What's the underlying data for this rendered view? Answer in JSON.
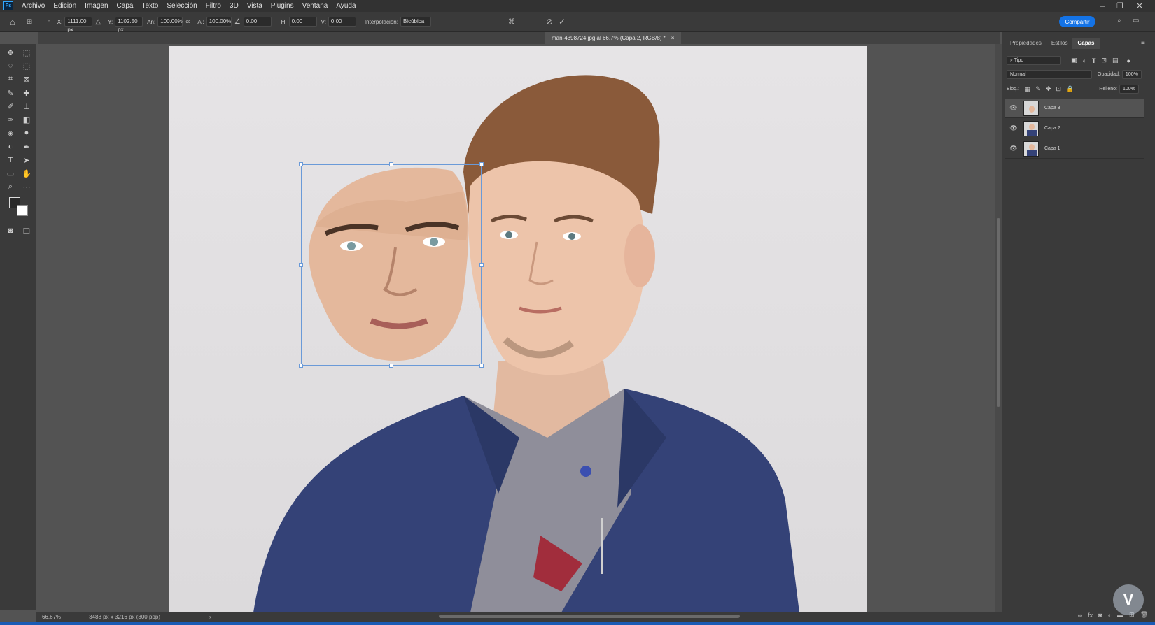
{
  "menu": [
    "Archivo",
    "Edición",
    "Imagen",
    "Capa",
    "Texto",
    "Selección",
    "Filtro",
    "3D",
    "Vista",
    "Plugins",
    "Ventana",
    "Ayuda"
  ],
  "app_logo": "Ps",
  "options": {
    "x_label": "X:",
    "x_value": "1111.00 px",
    "y_label": "Y:",
    "y_value": "1102.50 px",
    "w_label": "An:",
    "w_value": "100.00%",
    "h_label": "Al:",
    "h_value": "100.00%",
    "angle_value": "0.00",
    "hskew_label": "H:",
    "hskew_value": "0.00",
    "vskew_label": "V:",
    "vskew_value": "0.00",
    "interp_label": "Interpolación:",
    "interp_value": "Bicúbica"
  },
  "share_label": "Compartir",
  "document_tab": {
    "title": "man-4398724.jpg al 66.7% (Capa 2, RGB/8) *",
    "close": "×"
  },
  "status": {
    "zoom": "66.67%",
    "doc_info": "3488 px x 3216 px (300 ppp)"
  },
  "panel": {
    "tabs": [
      "Propiedades",
      "Estilos",
      "Capas"
    ],
    "active_tab": "Capas",
    "filter_value": "Tipo",
    "blend_mode": "Normal",
    "opacity_label": "Opacidad:",
    "opacity_value": "100%",
    "lock_label": "Bloq.:",
    "fill_label": "Relleno:",
    "fill_value": "100%",
    "layers": [
      {
        "name": "Capa 3",
        "selected": true
      },
      {
        "name": "Capa 2",
        "selected": false
      },
      {
        "name": "Capa 1",
        "selected": false
      }
    ]
  },
  "colors": {
    "accent": "#1473e6",
    "transform_box": "#6a9ad8"
  },
  "watermark_letter": "V"
}
